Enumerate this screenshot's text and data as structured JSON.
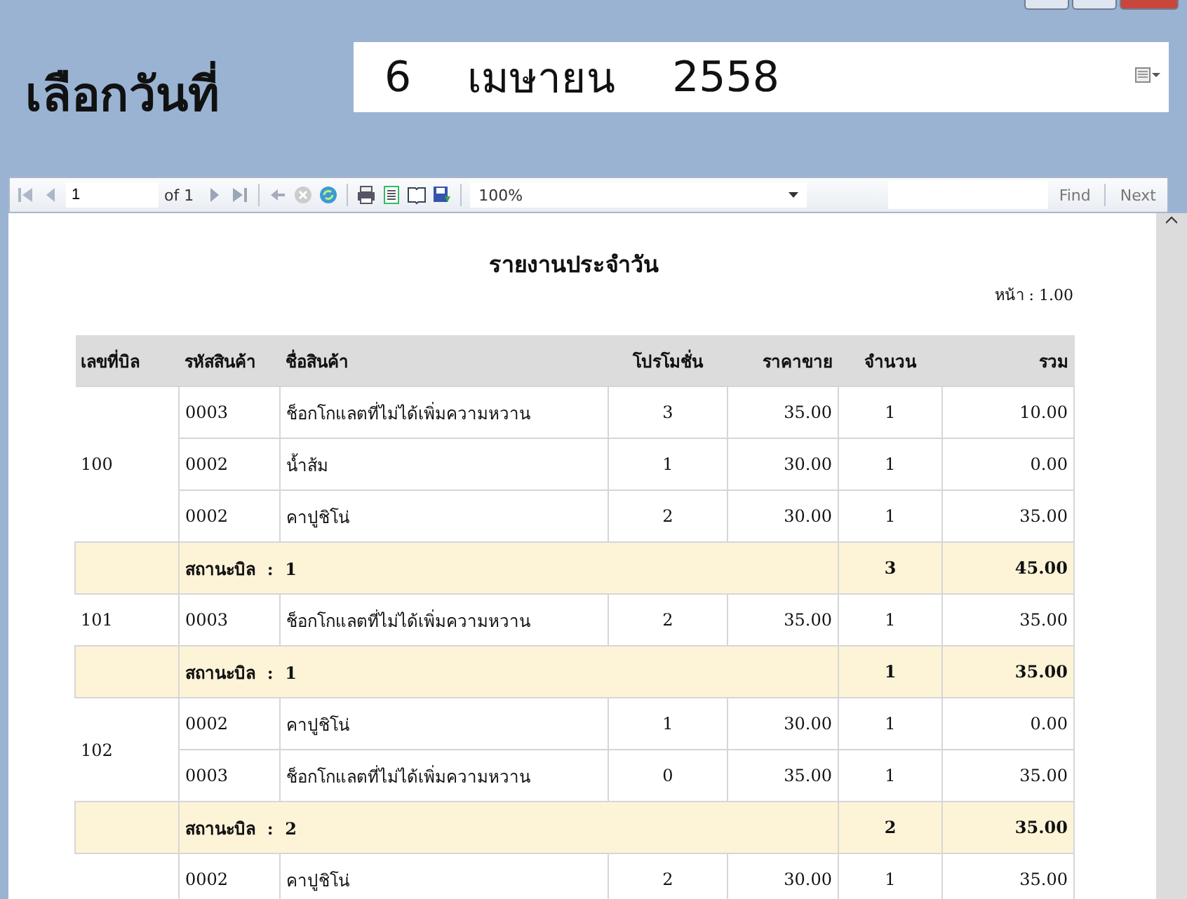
{
  "header": {
    "label": "เลือกวันที่",
    "date": {
      "day": "6",
      "month": "เมษายน",
      "year": "2558"
    }
  },
  "toolbar": {
    "page": "1",
    "of": "of 1",
    "first_disabled": true,
    "prev_disabled": true,
    "zoom": "100%",
    "find": "Find",
    "next": "Next"
  },
  "report": {
    "title": "รายงานประจำวัน",
    "page_label": "หน้า : 1.00",
    "columns": [
      "เลขที่บิล",
      "รหัสสินค้า",
      "ชื่อสินค้า",
      "โปรโมชั่น",
      "ราคาขาย",
      "จำนวน",
      "รวม"
    ],
    "bills": [
      {
        "bill": "100",
        "items": [
          {
            "code": "0003",
            "name": "ช็อกโกแลตที่ไม่ได้เพิ่มความหวาน",
            "promo": "3",
            "price": "35.00",
            "qty": "1",
            "total": "10.00"
          },
          {
            "code": "0002",
            "name": "น้ำส้ม",
            "promo": "1",
            "price": "30.00",
            "qty": "1",
            "total": "0.00"
          },
          {
            "code": "0002",
            "name": "คาปูชิโน่",
            "promo": "2",
            "price": "30.00",
            "qty": "1",
            "total": "35.00"
          }
        ],
        "summary": {
          "label": "สถานะบิล",
          "sep": ":",
          "value": "1",
          "qty": "3",
          "total": "45.00"
        }
      },
      {
        "bill": "101",
        "items": [
          {
            "code": "0003",
            "name": "ช็อกโกแลตที่ไม่ได้เพิ่มความหวาน",
            "promo": "2",
            "price": "35.00",
            "qty": "1",
            "total": "35.00"
          }
        ],
        "summary": {
          "label": "สถานะบิล",
          "sep": ":",
          "value": "1",
          "qty": "1",
          "total": "35.00"
        }
      },
      {
        "bill": "102",
        "items": [
          {
            "code": "0002",
            "name": "คาปูชิโน่",
            "promo": "1",
            "price": "30.00",
            "qty": "1",
            "total": "0.00"
          },
          {
            "code": "0003",
            "name": "ช็อกโกแลตที่ไม่ได้เพิ่มความหวาน",
            "promo": "0",
            "price": "35.00",
            "qty": "1",
            "total": "35.00"
          }
        ],
        "summary": {
          "label": "สถานะบิล",
          "sep": ":",
          "value": "2",
          "qty": "2",
          "total": "35.00"
        }
      },
      {
        "items": [
          {
            "code": "0002",
            "name": "คาปูชิโน่",
            "promo": "2",
            "price": "30.00",
            "qty": "1",
            "total": "35.00"
          }
        ]
      }
    ]
  }
}
